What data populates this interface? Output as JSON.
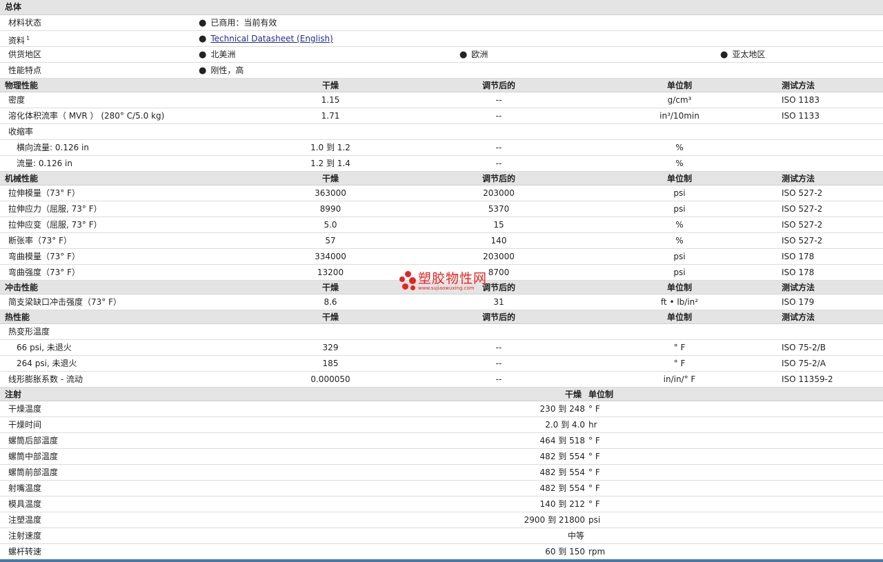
{
  "general": {
    "title": "总体",
    "status_label": "材料状态",
    "status_value": "已商用：当前有效",
    "docs_label": "资料",
    "docs_sup": "1",
    "docs_link": "Technical Datasheet (English)",
    "region_label": "供货地区",
    "regions": [
      "北美洲",
      "欧洲",
      "亚太地区"
    ],
    "features_label": "性能特点",
    "features_value": "刚性，高"
  },
  "columns": {
    "dry": "干燥",
    "cond": "调节后的",
    "unit": "单位制",
    "method": "测试方法"
  },
  "physical": {
    "title": "物理性能",
    "rows": [
      {
        "label": "密度",
        "dry": "1.15",
        "cond": "--",
        "unit": "g/cm³",
        "method": "ISO 1183"
      },
      {
        "label": "溶化体积流率（ MVR ） (280° C/5.0 kg)",
        "dry": "1.71",
        "cond": "--",
        "unit": "in³/10min",
        "method": "ISO 1133"
      },
      {
        "label": "收缩率",
        "dry": "",
        "cond": "",
        "unit": "",
        "method": ""
      },
      {
        "label": "横向流量: 0.126 in",
        "dry": "1.0 到  1.2",
        "cond": "--",
        "unit": "%",
        "method": ""
      },
      {
        "label": "流量: 0.126 in",
        "dry": "1.2 到  1.4",
        "cond": "--",
        "unit": "%",
        "method": ""
      }
    ]
  },
  "mechanical": {
    "title": "机械性能",
    "rows": [
      {
        "label": "拉伸模量（73° F）",
        "dry": "363000",
        "cond": "203000",
        "unit": "psi",
        "method": "ISO 527-2"
      },
      {
        "label": "拉伸应力（屈服, 73° F）",
        "dry": "8990",
        "cond": "5370",
        "unit": "psi",
        "method": "ISO 527-2"
      },
      {
        "label": "拉伸应变（屈服, 73° F）",
        "dry": "5.0",
        "cond": "15",
        "unit": "%",
        "method": "ISO 527-2"
      },
      {
        "label": "断张率（73° F）",
        "dry": "57",
        "cond": "140",
        "unit": "%",
        "method": "ISO 527-2"
      },
      {
        "label": "弯曲模量（73° F）",
        "dry": "334000",
        "cond": "203000",
        "unit": "psi",
        "method": "ISO 178"
      },
      {
        "label": "弯曲强度（73° F）",
        "dry": "13200",
        "cond": "8700",
        "unit": "psi",
        "method": "ISO 178"
      }
    ]
  },
  "impact": {
    "title": "冲击性能",
    "rows": [
      {
        "label": "简支梁缺口冲击强度（73° F）",
        "dry": "8.6",
        "cond": "31",
        "unit": "ft • lb/in²",
        "method": "ISO 179"
      }
    ]
  },
  "thermal": {
    "title": "热性能",
    "rows": [
      {
        "label": "热变形温度",
        "dry": "",
        "cond": "",
        "unit": "",
        "method": ""
      },
      {
        "label": "66 psi, 未退火",
        "dry": "329",
        "cond": "--",
        "unit": "° F",
        "method": "ISO 75-2/B"
      },
      {
        "label": "264 psi, 未退火",
        "dry": "185",
        "cond": "--",
        "unit": "° F",
        "method": "ISO 75-2/A"
      },
      {
        "label": "线形膨胀系数 - 流动",
        "dry": "0.000050",
        "cond": "--",
        "unit": "in/in/° F",
        "method": "ISO 11359-2"
      }
    ]
  },
  "injection": {
    "title": "注射",
    "dry_header": "干燥",
    "unit_header": "单位制",
    "rows": [
      {
        "label": "干燥温度",
        "value": "230 到  248",
        "unit": "° F"
      },
      {
        "label": "干燥时间",
        "value": "2.0 到  4.0",
        "unit": "hr"
      },
      {
        "label": "螺筒后部温度",
        "value": "464 到  518",
        "unit": "° F"
      },
      {
        "label": "螺筒中部温度",
        "value": "482 到  554",
        "unit": "° F"
      },
      {
        "label": "螺筒前部温度",
        "value": "482 到  554",
        "unit": "° F"
      },
      {
        "label": "射嘴温度",
        "value": "482 到  554",
        "unit": "° F"
      },
      {
        "label": "模具温度",
        "value": "140 到  212",
        "unit": "° F"
      },
      {
        "label": "注塑温度",
        "value": "2900 到  21800",
        "unit": "psi"
      },
      {
        "label": "注射速度",
        "value": "",
        "unit": "",
        "center": "中等"
      },
      {
        "label": "螺杆转速",
        "value": "60 到  150",
        "unit": "rpm"
      }
    ]
  },
  "watermark": {
    "cn": "塑胶物性网",
    "en": "www.sujiaowuxing.com"
  }
}
